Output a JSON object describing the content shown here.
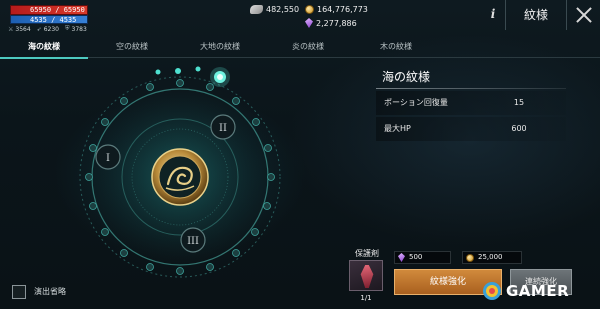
{
  "player": {
    "hp": "65950 / 65950",
    "mp": "4535 / 4535",
    "stats": [
      {
        "icon": "sword-icon",
        "value": "3564"
      },
      {
        "icon": "arrow-icon",
        "value": "6230"
      },
      {
        "icon": "shield-icon",
        "value": "3783"
      }
    ]
  },
  "currency": {
    "wing": "482,550",
    "gold": "164,776,773",
    "gem": "2,277,886"
  },
  "header": {
    "title": "紋様",
    "info_icon": "info-icon",
    "close_icon": "close-icon"
  },
  "tabs": [
    {
      "label": "海の紋様",
      "active": true
    },
    {
      "label": "空の紋様",
      "active": false
    },
    {
      "label": "大地の紋様",
      "active": false
    },
    {
      "label": "炎の紋様",
      "active": false
    },
    {
      "label": "木の紋様",
      "active": false
    }
  ],
  "emblem": {
    "nodes": [
      "I",
      "II",
      "III"
    ],
    "ring_text": "SPIRIT ARMOUR PROTECTION GIVE",
    "accent": "#3fd6c4"
  },
  "panel": {
    "title": "海の紋様",
    "rows": [
      {
        "label": "ポーション回復量",
        "value": "15"
      },
      {
        "label": "最大HP",
        "value": "600"
      }
    ]
  },
  "bottom": {
    "skip_label": "演出省略",
    "protect_label": "保護剤",
    "protect_count": "1/1",
    "cost_gem": "500",
    "cost_gold": "25,000",
    "enhance_label": "紋様強化",
    "continuous_label": "連続強化"
  },
  "watermark": {
    "text": "GAMER"
  }
}
